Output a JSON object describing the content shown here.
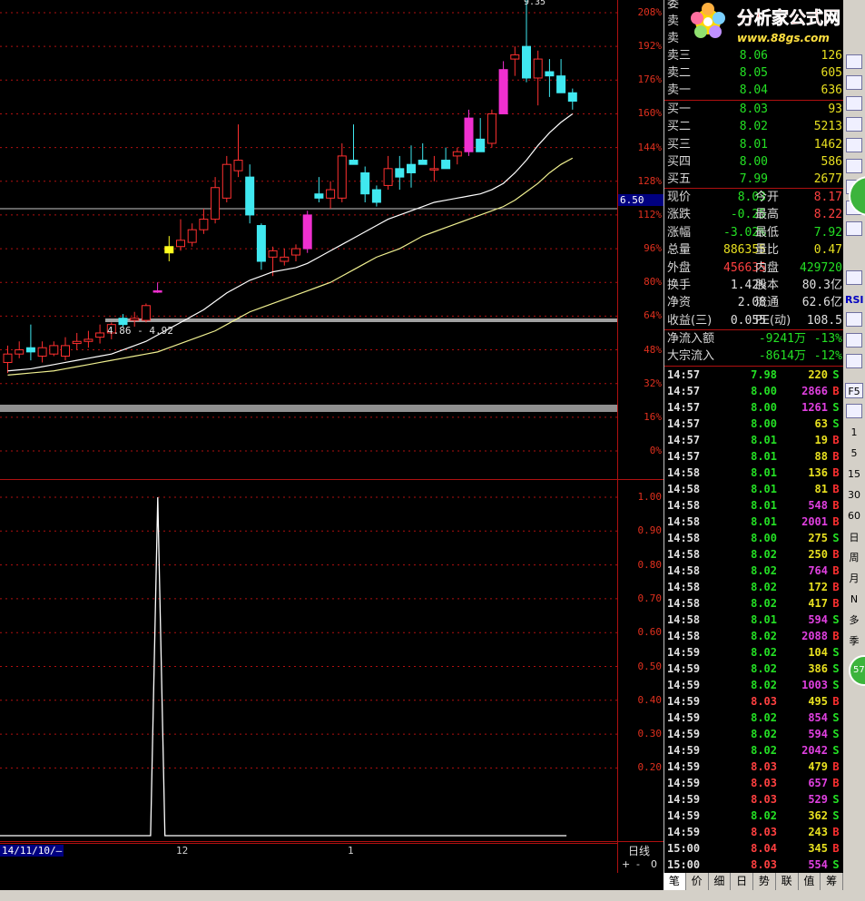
{
  "chart_data": [
    {
      "type": "candlestick",
      "ylim": [
        0,
        220
      ],
      "y_axis_ticks": [
        "208%",
        "192%",
        "176%",
        "160%",
        "144%",
        "128%",
        "112%",
        "96%",
        "80%",
        "64%",
        "48%",
        "32%",
        "16%",
        "0%"
      ],
      "current_price_label": "6.50",
      "annotations": [
        "4.86 - 4.92",
        "9.35"
      ],
      "candles": [
        {
          "o": 42,
          "h": 50,
          "l": 37,
          "c": 46,
          "color": "red"
        },
        {
          "o": 48,
          "h": 52,
          "l": 44,
          "c": 46,
          "color": "red"
        },
        {
          "o": 47,
          "h": 60,
          "l": 43,
          "c": 49,
          "color": "cyan"
        },
        {
          "o": 45,
          "h": 52,
          "l": 42,
          "c": 49,
          "color": "red"
        },
        {
          "o": 50,
          "h": 52,
          "l": 45,
          "c": 46,
          "color": "red"
        },
        {
          "o": 45,
          "h": 54,
          "l": 43,
          "c": 50,
          "color": "red"
        },
        {
          "o": 51,
          "h": 56,
          "l": 48,
          "c": 52,
          "color": "red"
        },
        {
          "o": 52,
          "h": 57,
          "l": 49,
          "c": 53,
          "color": "red"
        },
        {
          "o": 54,
          "h": 60,
          "l": 51,
          "c": 56,
          "color": "red"
        },
        {
          "o": 56,
          "h": 61,
          "l": 53,
          "c": 60,
          "color": "red"
        },
        {
          "o": 63,
          "h": 65,
          "l": 59,
          "c": 60,
          "color": "cyan"
        },
        {
          "o": 62,
          "h": 66,
          "l": 59,
          "c": 63,
          "color": "red"
        },
        {
          "o": 62,
          "h": 70,
          "l": 61,
          "c": 69,
          "color": "red"
        },
        {
          "o": 76,
          "h": 80,
          "l": 75,
          "c": 76,
          "color": "magenta"
        },
        {
          "o": 94,
          "h": 102,
          "l": 90,
          "c": 97,
          "color": "yellow"
        },
        {
          "o": 97,
          "h": 110,
          "l": 95,
          "c": 100,
          "color": "red"
        },
        {
          "o": 99,
          "h": 108,
          "l": 97,
          "c": 105,
          "color": "red"
        },
        {
          "o": 105,
          "h": 115,
          "l": 103,
          "c": 110,
          "color": "red"
        },
        {
          "o": 110,
          "h": 130,
          "l": 108,
          "c": 125,
          "color": "red"
        },
        {
          "o": 120,
          "h": 140,
          "l": 118,
          "c": 136,
          "color": "red"
        },
        {
          "o": 133,
          "h": 155,
          "l": 130,
          "c": 138,
          "color": "red"
        },
        {
          "o": 130,
          "h": 136,
          "l": 108,
          "c": 112,
          "color": "cyan"
        },
        {
          "o": 107,
          "h": 108,
          "l": 86,
          "c": 90,
          "color": "cyan"
        },
        {
          "o": 95,
          "h": 97,
          "l": 83,
          "c": 92,
          "color": "red"
        },
        {
          "o": 92,
          "h": 96,
          "l": 88,
          "c": 90,
          "color": "red"
        },
        {
          "o": 93,
          "h": 98,
          "l": 90,
          "c": 96,
          "color": "red"
        },
        {
          "o": 112,
          "h": 114,
          "l": 94,
          "c": 96,
          "color": "magenta"
        },
        {
          "o": 122,
          "h": 130,
          "l": 118,
          "c": 120,
          "color": "cyan"
        },
        {
          "o": 120,
          "h": 128,
          "l": 115,
          "c": 124,
          "color": "red"
        },
        {
          "o": 120,
          "h": 146,
          "l": 118,
          "c": 140,
          "color": "red"
        },
        {
          "o": 138,
          "h": 155,
          "l": 136,
          "c": 136,
          "color": "cyan"
        },
        {
          "o": 132,
          "h": 135,
          "l": 118,
          "c": 122,
          "color": "cyan"
        },
        {
          "o": 118,
          "h": 126,
          "l": 116,
          "c": 124,
          "color": "cyan"
        },
        {
          "o": 126,
          "h": 140,
          "l": 124,
          "c": 134,
          "color": "red"
        },
        {
          "o": 134,
          "h": 140,
          "l": 124,
          "c": 130,
          "color": "cyan"
        },
        {
          "o": 136,
          "h": 145,
          "l": 125,
          "c": 132,
          "color": "cyan"
        },
        {
          "o": 138,
          "h": 146,
          "l": 136,
          "c": 136,
          "color": "cyan"
        },
        {
          "o": 134,
          "h": 140,
          "l": 128,
          "c": 134,
          "color": "red"
        },
        {
          "o": 138,
          "h": 144,
          "l": 134,
          "c": 134,
          "color": "cyan"
        },
        {
          "o": 140,
          "h": 144,
          "l": 136,
          "c": 142,
          "color": "red"
        },
        {
          "o": 158,
          "h": 162,
          "l": 140,
          "c": 142,
          "color": "magenta"
        },
        {
          "o": 148,
          "h": 158,
          "l": 145,
          "c": 142,
          "color": "cyan"
        },
        {
          "o": 146,
          "h": 162,
          "l": 144,
          "c": 160,
          "color": "red"
        },
        {
          "o": 181,
          "h": 185,
          "l": 160,
          "c": 160,
          "color": "magenta"
        },
        {
          "o": 186,
          "h": 192,
          "l": 178,
          "c": 188,
          "color": "red"
        },
        {
          "o": 192,
          "h": 220,
          "l": 175,
          "c": 177,
          "color": "cyan"
        },
        {
          "o": 177,
          "h": 190,
          "l": 164,
          "c": 186,
          "color": "red"
        },
        {
          "o": 180,
          "h": 186,
          "l": 168,
          "c": 178,
          "color": "cyan"
        },
        {
          "o": 178,
          "h": 186,
          "l": 170,
          "c": 170,
          "color": "cyan"
        },
        {
          "o": 170,
          "h": 172,
          "l": 162,
          "c": 166,
          "color": "cyan"
        }
      ],
      "ma_white": [
        38,
        38.5,
        39,
        40,
        41,
        42,
        43,
        44,
        45,
        46,
        48,
        50,
        52,
        55,
        58,
        61,
        64,
        67,
        71,
        75,
        78,
        81,
        83,
        85,
        86,
        87,
        89,
        92,
        95,
        98,
        101,
        104,
        107,
        110,
        112,
        114,
        116,
        118,
        119,
        120,
        121,
        122,
        124,
        127,
        132,
        138,
        145,
        151,
        156,
        160
      ],
      "ma_yellow": [
        36,
        36.5,
        37,
        37.5,
        38,
        39,
        40,
        41,
        42,
        43,
        44,
        45,
        46,
        47,
        49,
        51,
        53,
        55,
        57,
        60,
        63,
        66,
        68,
        70,
        72,
        74,
        76,
        78,
        80,
        83,
        86,
        89,
        92,
        94,
        96,
        99,
        102,
        104,
        106,
        108,
        110,
        112,
        114,
        116,
        119,
        123,
        127,
        132,
        136,
        139
      ]
    },
    {
      "type": "line",
      "ylim": [
        0,
        1.1
      ],
      "y_axis_ticks": [
        "1.00",
        "0.90",
        "0.80",
        "0.70",
        "0.60",
        "0.50",
        "0.40",
        "0.30",
        "0.20"
      ],
      "values": [
        0,
        0,
        0,
        0,
        0,
        0,
        0,
        0,
        0,
        0,
        0,
        0,
        0,
        0,
        0,
        0,
        0,
        0,
        0,
        0,
        0,
        0,
        1,
        0,
        0,
        0,
        0,
        0,
        0,
        0,
        0,
        0,
        0,
        0,
        0,
        0,
        0,
        0,
        0,
        0,
        0,
        0,
        0,
        0,
        0,
        0,
        0,
        0,
        0,
        0,
        0,
        0,
        0,
        0,
        0,
        0,
        0,
        0,
        0,
        0,
        0,
        0,
        0,
        0,
        0,
        0,
        0,
        0,
        0,
        0,
        0,
        0,
        0,
        0,
        0,
        0,
        0,
        0,
        0,
        0
      ]
    }
  ],
  "date_axis": {
    "start": "14/11/10/—",
    "marks": [
      "12",
      "1"
    ]
  },
  "bottom_axis_label": "日线",
  "zoom_controls": [
    "+",
    "-",
    "0"
  ],
  "logo": {
    "title": "分析家公式网",
    "url": "www.88gs.com"
  },
  "order_book": {
    "sell": [
      {
        "label": "卖三",
        "price": "8.06",
        "vol": "126"
      },
      {
        "label": "卖二",
        "price": "8.05",
        "vol": "605"
      },
      {
        "label": "卖一",
        "price": "8.04",
        "vol": "636"
      }
    ],
    "buy": [
      {
        "label": "买一",
        "price": "8.03",
        "vol": "93"
      },
      {
        "label": "买二",
        "price": "8.02",
        "vol": "5213"
      },
      {
        "label": "买三",
        "price": "8.01",
        "vol": "1462"
      },
      {
        "label": "买四",
        "price": "8.00",
        "vol": "586"
      },
      {
        "label": "买五",
        "price": "7.99",
        "vol": "2677"
      }
    ]
  },
  "quote": [
    {
      "l1": "现价",
      "v1": "8.03",
      "c1": "#24e024",
      "l2": "今开",
      "v2": "8.17",
      "c2": "#ff4040"
    },
    {
      "l1": "涨跌",
      "v1": "-0.25",
      "c1": "#24e024",
      "l2": "最高",
      "v2": "8.22",
      "c2": "#ff4040"
    },
    {
      "l1": "涨幅",
      "v1": "-3.02%",
      "c1": "#24e024",
      "l2": "最低",
      "v2": "7.92",
      "c2": "#24e024"
    },
    {
      "l1": "总量",
      "v1": "886355",
      "c1": "#e8e020",
      "l2": "量比",
      "v2": "0.47",
      "c2": "#e8e020"
    },
    {
      "l1": "外盘",
      "v1": "456635",
      "c1": "#ff4040",
      "l2": "内盘",
      "v2": "429720",
      "c2": "#24e024"
    },
    {
      "l1": "换手",
      "v1": "1.42%",
      "c1": "#e0e0e0",
      "l2": "股本",
      "v2": "80.3亿",
      "c2": "#e0e0e0"
    },
    {
      "l1": "净资",
      "v1": "2.08",
      "c1": "#e0e0e0",
      "l2": "流通",
      "v2": "62.6亿",
      "c2": "#e0e0e0"
    },
    {
      "l1": "收益(三)",
      "v1": "0.055",
      "c1": "#e0e0e0",
      "l2": "PE(动)",
      "v2": "108.5",
      "c2": "#e0e0e0"
    }
  ],
  "flow": [
    {
      "label": "净流入额",
      "amount": "-9241万",
      "pct": "-13%"
    },
    {
      "label": "大宗流入",
      "amount": "-8614万",
      "pct": "-12%"
    }
  ],
  "ticks": [
    {
      "t": "14:57",
      "p": "7.98",
      "v": "220",
      "s": "S"
    },
    {
      "t": "14:57",
      "p": "8.00",
      "v": "2866",
      "s": "B"
    },
    {
      "t": "14:57",
      "p": "8.00",
      "v": "1261",
      "s": "S"
    },
    {
      "t": "14:57",
      "p": "8.00",
      "v": "63",
      "s": "S"
    },
    {
      "t": "14:57",
      "p": "8.01",
      "v": "19",
      "s": "B"
    },
    {
      "t": "14:57",
      "p": "8.01",
      "v": "88",
      "s": "B"
    },
    {
      "t": "14:58",
      "p": "8.01",
      "v": "136",
      "s": "B"
    },
    {
      "t": "14:58",
      "p": "8.01",
      "v": "81",
      "s": "B"
    },
    {
      "t": "14:58",
      "p": "8.01",
      "v": "548",
      "s": "B"
    },
    {
      "t": "14:58",
      "p": "8.01",
      "v": "2001",
      "s": "B"
    },
    {
      "t": "14:58",
      "p": "8.00",
      "v": "275",
      "s": "S"
    },
    {
      "t": "14:58",
      "p": "8.02",
      "v": "250",
      "s": "B"
    },
    {
      "t": "14:58",
      "p": "8.02",
      "v": "764",
      "s": "B"
    },
    {
      "t": "14:58",
      "p": "8.02",
      "v": "172",
      "s": "B"
    },
    {
      "t": "14:58",
      "p": "8.02",
      "v": "417",
      "s": "B"
    },
    {
      "t": "14:58",
      "p": "8.01",
      "v": "594",
      "s": "S"
    },
    {
      "t": "14:58",
      "p": "8.02",
      "v": "2088",
      "s": "B"
    },
    {
      "t": "14:59",
      "p": "8.02",
      "v": "104",
      "s": "S"
    },
    {
      "t": "14:59",
      "p": "8.02",
      "v": "386",
      "s": "S"
    },
    {
      "t": "14:59",
      "p": "8.02",
      "v": "1003",
      "s": "S"
    },
    {
      "t": "14:59",
      "p": "8.03",
      "v": "495",
      "s": "B"
    },
    {
      "t": "14:59",
      "p": "8.02",
      "v": "854",
      "s": "S"
    },
    {
      "t": "14:59",
      "p": "8.02",
      "v": "594",
      "s": "S"
    },
    {
      "t": "14:59",
      "p": "8.02",
      "v": "2042",
      "s": "S"
    },
    {
      "t": "14:59",
      "p": "8.03",
      "v": "479",
      "s": "B"
    },
    {
      "t": "14:59",
      "p": "8.03",
      "v": "657",
      "s": "B"
    },
    {
      "t": "14:59",
      "p": "8.03",
      "v": "529",
      "s": "S"
    },
    {
      "t": "14:59",
      "p": "8.02",
      "v": "362",
      "s": "S"
    },
    {
      "t": "14:59",
      "p": "8.03",
      "v": "243",
      "s": "B"
    },
    {
      "t": "15:00",
      "p": "8.04",
      "v": "345",
      "s": "B"
    },
    {
      "t": "15:00",
      "p": "8.03",
      "v": "554",
      "s": "S"
    }
  ],
  "bottom_tabs": [
    "笔",
    "价",
    "细",
    "日",
    "势",
    "联",
    "值",
    "筹"
  ],
  "toolbar_text": [
    "RSI",
    "F5",
    "1",
    "5",
    "15",
    "30",
    "60",
    "日",
    "周",
    "月",
    "N",
    "多",
    "季",
    "57"
  ],
  "colors": {
    "up": "#ff3030",
    "down": "#40e8f0",
    "ma1": "#ffffff",
    "ma2": "#f0f090",
    "grid": "#b01010",
    "buy": "#ff3030",
    "sell": "#24e024"
  }
}
